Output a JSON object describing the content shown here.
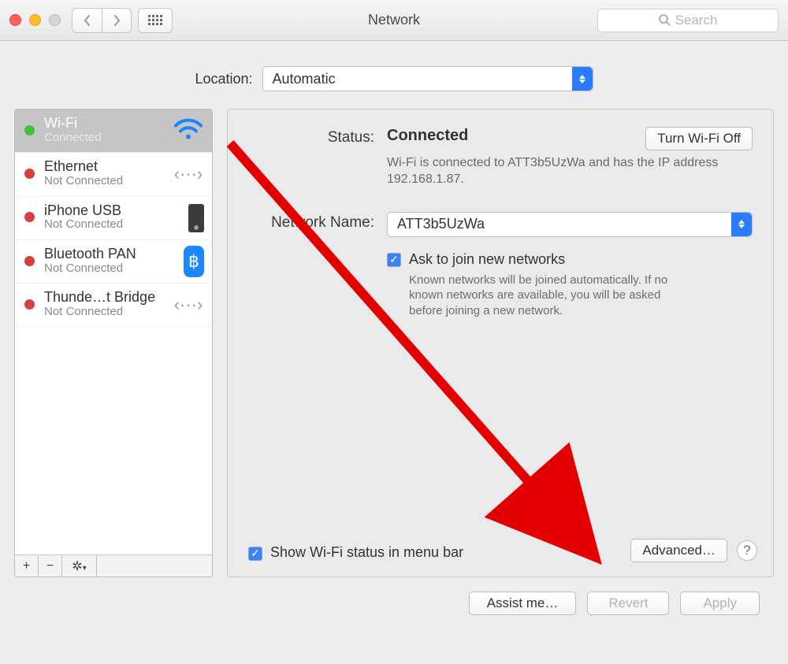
{
  "window": {
    "title": "Network"
  },
  "search": {
    "placeholder": "Search"
  },
  "location": {
    "label": "Location:",
    "value": "Automatic"
  },
  "sidebar": {
    "items": [
      {
        "name": "Wi-Fi",
        "sub": "Connected",
        "status": "green",
        "selected": true
      },
      {
        "name": "Ethernet",
        "sub": "Not Connected",
        "status": "red"
      },
      {
        "name": "iPhone USB",
        "sub": "Not Connected",
        "status": "red"
      },
      {
        "name": "Bluetooth PAN",
        "sub": "Not Connected",
        "status": "red"
      },
      {
        "name": "Thunde…t Bridge",
        "sub": "Not Connected",
        "status": "red"
      }
    ]
  },
  "details": {
    "status_label": "Status:",
    "status_value": "Connected",
    "turn_off": "Turn Wi-Fi Off",
    "status_desc": "Wi-Fi is connected to ATT3b5UzWa and has the IP address 192.168.1.87.",
    "netname_label": "Network Name:",
    "netname_value": "ATT3b5UzWa",
    "ask_label": "Ask to join new networks",
    "ask_desc": "Known networks will be joined automatically. If no known networks are available, you will be asked before joining a new network.",
    "show_status": "Show Wi-Fi status in menu bar",
    "advanced": "Advanced…",
    "help": "?"
  },
  "footer": {
    "assist": "Assist me…",
    "revert": "Revert",
    "apply": "Apply"
  }
}
